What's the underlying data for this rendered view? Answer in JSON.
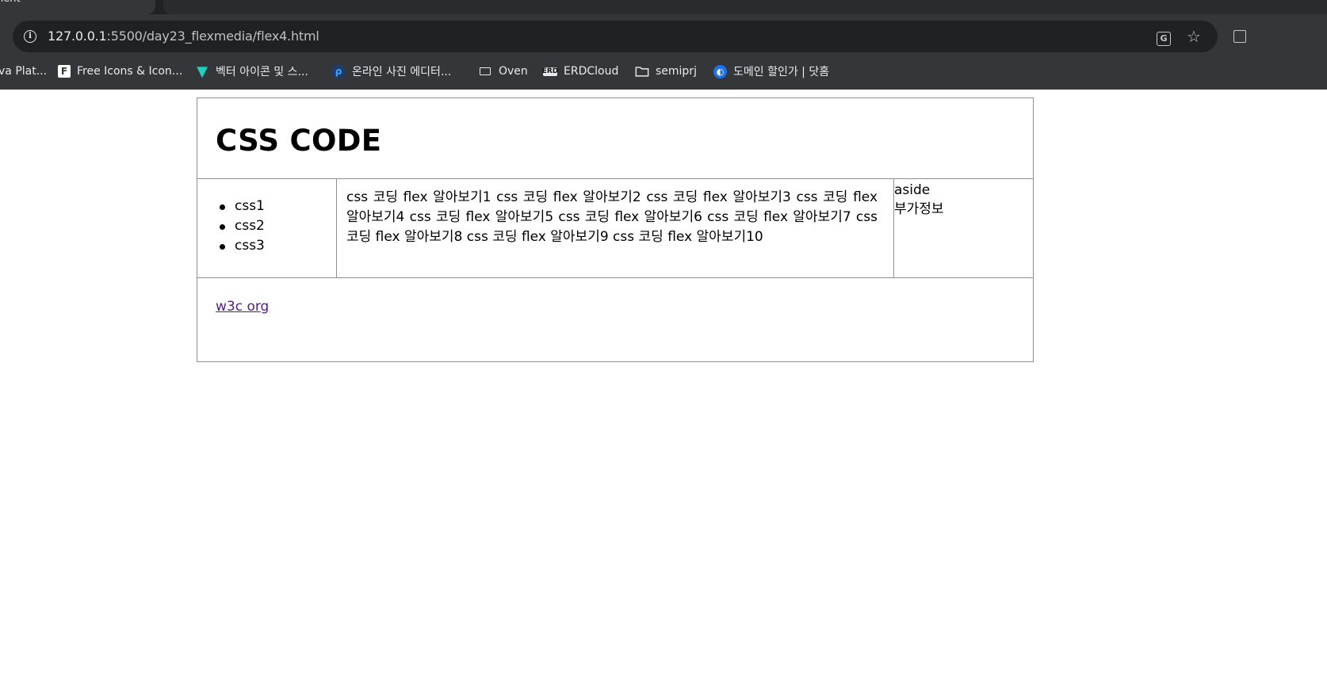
{
  "browser": {
    "tab_title": "nent",
    "url_host": "127.0.0.1",
    "url_path": ":5500/day23_flexmedia/flex4.html",
    "bookmarks": [
      {
        "label": "va Plat...",
        "icon": "java-icon"
      },
      {
        "label": "Free Icons & Icon...",
        "icon": "flaticon-icon"
      },
      {
        "label": "벡터 아이콘 및 스...",
        "icon": "vector-icon"
      },
      {
        "label": "온라인 사진 에디터...",
        "icon": "photo-editor-icon"
      },
      {
        "label": "Oven",
        "icon": "oven-icon"
      },
      {
        "label": "ERDCloud",
        "icon": "erd-icon"
      },
      {
        "label": "semiprj",
        "icon": "folder-icon"
      },
      {
        "label": "도메인 할인가 | 닷홈",
        "icon": "dothome-icon"
      }
    ]
  },
  "page": {
    "header_title": "CSS CODE",
    "nav_items": [
      "css1",
      "css2",
      "css3"
    ],
    "article_text": "css 코딩 flex 알아보기1 css 코딩 flex 알아보기2 css 코딩 flex 알아보기3 css 코딩 flex 알아보기4 css 코딩 flex 알아보기5 css 코딩 flex 알아보기6 css 코딩 flex 알아보기7 css 코딩 flex 알아보기8 css 코딩 flex 알아보기9 css 코딩 flex 알아보기10",
    "aside_line1": "aside",
    "aside_line2": "부가정보",
    "footer_link": "w3c org"
  },
  "colors": {
    "chrome_dark": "#202124",
    "chrome_toolbar": "#35363a",
    "border": "#8f8f8f",
    "visited_link": "#551a8b"
  }
}
